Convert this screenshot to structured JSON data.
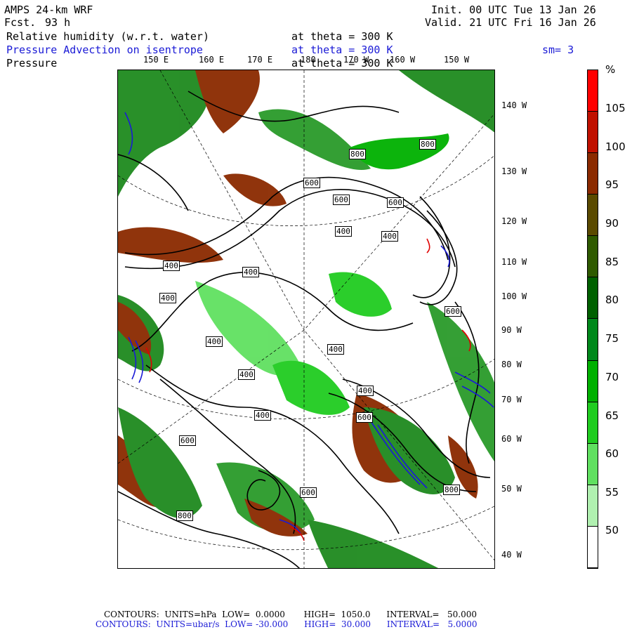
{
  "header": {
    "model": "AMPS 24-km WRF",
    "fcst_label": "Fcst.",
    "fcst_value": "93 h",
    "init": "Init. 00 UTC Tue 13 Jan 26",
    "valid": "Valid. 21 UTC Fri 16 Jan 26",
    "field1": "Relative humidity (w.r.t. water)",
    "field1_level": "at theta = 300 K",
    "field2": "Pressure Advection on isentrope",
    "field2_level": "at theta = 300 K",
    "smooth": "sm= 3",
    "field3": "Pressure",
    "field3_level": "at theta = 300 K"
  },
  "lon_labels": [
    "150 E",
    "160 E",
    "170 E",
    "180",
    "170 W",
    "160 W",
    "150 W"
  ],
  "lat_labels": [
    "140 W",
    "130 W",
    "120 W",
    "110 W",
    "100 W",
    "90 W",
    "80 W",
    "70 W",
    "60 W",
    "50 W",
    "40 W"
  ],
  "contour_labels": [
    "800",
    "800",
    "600",
    "600",
    "600",
    "400",
    "400",
    "400",
    "400",
    "400",
    "400",
    "400",
    "400",
    "400",
    "400",
    "600",
    "600",
    "600",
    "800",
    "800",
    "600"
  ],
  "colorbar": {
    "unit": "%",
    "labels": [
      "105",
      "100",
      "95",
      "90",
      "85",
      "80",
      "75",
      "70",
      "65",
      "60",
      "55",
      "50"
    ],
    "colors": [
      "#ff0000",
      "#c01000",
      "#8b2a00",
      "#5a4a00",
      "#2e5a00",
      "#006000",
      "#00881a",
      "#00b000",
      "#20cc20",
      "#60e060",
      "#b0f0b0",
      "#ffffff"
    ]
  },
  "footer": {
    "line1": "CONTOURS:  UNITS=hPa  LOW=  0.0000       HIGH=  1050.0      INTERVAL=   50.000",
    "line2": "CONTOURS:  UNITS=ubar/s  LOW= -30.000      HIGH=  30.000      INTERVAL=   5.0000"
  }
}
